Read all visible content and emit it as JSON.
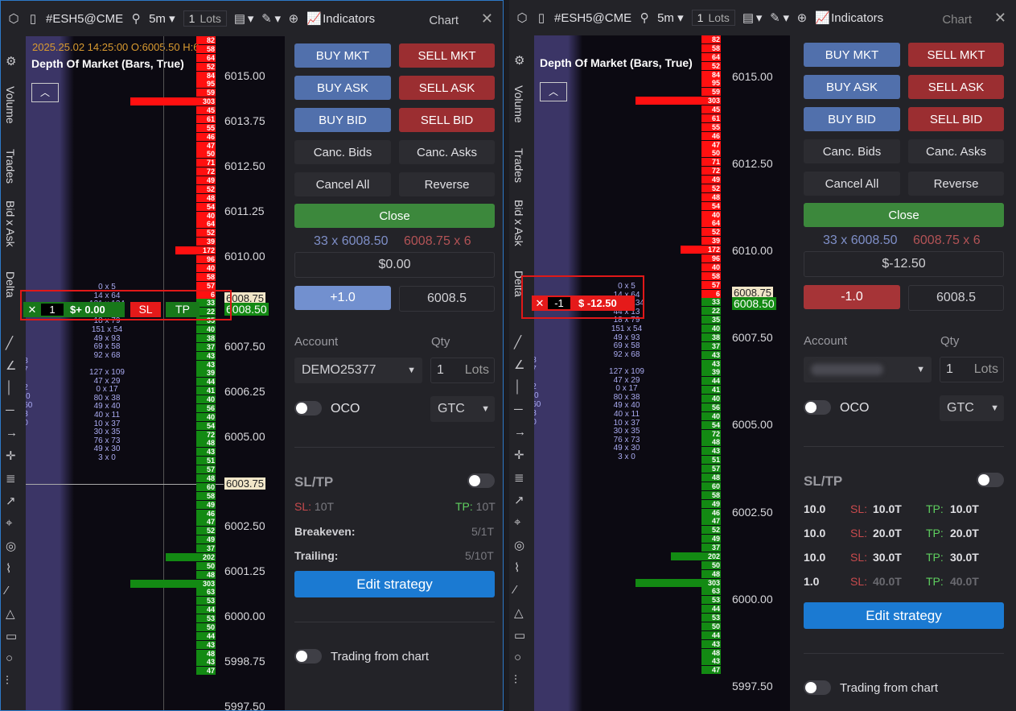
{
  "colors": {
    "buy": "#5170ac",
    "sell": "#9b2e31",
    "close": "#3c883c",
    "strategy": "#1b7ad2",
    "bid_bar": "#138a13",
    "ask_bar": "#ff1010"
  },
  "toolbar": {
    "symbol": "#ESH5@CME",
    "timeframe": "5m",
    "lots_value": "1",
    "lots_unit": "Lots",
    "indicators": "Indicators",
    "chart": "Chart"
  },
  "sidebar_tabs": [
    "Volume",
    "Trades",
    "Bid x Ask",
    "Delta"
  ],
  "left": {
    "info": "2025.25.02 14:25:00 O:6005.50 H:6",
    "study": "Depth Of Market (Bars, True)",
    "prices": [
      "6015.00",
      "6013.75",
      "6012.50",
      "6011.25",
      "6010.00",
      "6008.75",
      "6008.50",
      "6007.50",
      "6006.25",
      "6005.00",
      "6003.75",
      "6002.50",
      "6001.25",
      "6000.00",
      "5998.75",
      "5997.50"
    ],
    "position": {
      "qty": "1",
      "pnl": "$+ 0.00",
      "sl": "SL",
      "tp": "TP"
    },
    "panel": {
      "buy_mkt": "BUY MKT",
      "sell_mkt": "SELL MKT",
      "buy_ask": "BUY ASK",
      "sell_ask": "SELL ASK",
      "buy_bid": "BUY BID",
      "sell_bid": "SELL BID",
      "canc_bids": "Canc. Bids",
      "canc_asks": "Canc. Asks",
      "cancel_all": "Cancel All",
      "reverse": "Reverse",
      "close": "Close",
      "bid": "33 x 6008.50",
      "ask": "6008.75 x 6",
      "pnl": "$0.00",
      "pos": "+1.0",
      "price": "6008.5",
      "account_label": "Account",
      "qty_label": "Qty",
      "account": "DEMO25377",
      "qty": "1",
      "qty_unit": "Lots",
      "oco": "OCO",
      "tif": "GTC",
      "sltp": "SL/TP",
      "sl": "SL:",
      "sl_val": "10T",
      "tp": "TP:",
      "tp_val": "10T",
      "breakeven": "Breakeven:",
      "breakeven_val": "5/1T",
      "trailing": "Trailing:",
      "trailing_val": "5/10T",
      "edit": "Edit strategy",
      "trading": "Trading from chart"
    }
  },
  "right": {
    "study": "Depth Of Market (Bars, True)",
    "prices": [
      "6015.00",
      "6012.50",
      "6010.00",
      "6008.75",
      "6008.50",
      "6007.50",
      "6005.00",
      "6002.50",
      "6000.00",
      "5997.50"
    ],
    "position": {
      "qty": "-1",
      "pnl": "$ -12.50"
    },
    "panel": {
      "bid": "33 x 6008.50",
      "ask": "6008.75 x 6",
      "pnl": "$-12.50",
      "pos": "-1.0",
      "price": "6008.5",
      "account_label": "Account",
      "qty_label": "Qty",
      "qty": "1",
      "qty_unit": "Lots",
      "oco": "OCO",
      "tif": "GTC",
      "sltp": "SL/TP",
      "trading": "Trading from chart",
      "rows": [
        {
          "q": "10.0",
          "sl": "SL:",
          "slv": "10.0T",
          "tp": "TP:",
          "tpv": "10.0T"
        },
        {
          "q": "10.0",
          "sl": "SL:",
          "slv": "20.0T",
          "tp": "TP:",
          "tpv": "20.0T"
        },
        {
          "q": "10.0",
          "sl": "SL:",
          "slv": "30.0T",
          "tp": "TP:",
          "tpv": "30.0T"
        },
        {
          "q": "1.0",
          "sl": "SL:",
          "slv": "40.0T",
          "tp": "TP:",
          "tpv": "40.0T"
        }
      ]
    }
  },
  "asks": [
    "82",
    "58",
    "64",
    "52",
    "84",
    "95",
    "59",
    "303",
    "45",
    "61",
    "55",
    "46",
    "47",
    "50",
    "71",
    "72",
    "49",
    "52",
    "48",
    "54",
    "40",
    "64",
    "52",
    "39",
    "172",
    "96",
    "40",
    "58",
    "57",
    "6"
  ],
  "bids": [
    "33",
    "22",
    "35",
    "40",
    "38",
    "37",
    "43",
    "43",
    "39",
    "44",
    "41",
    "40",
    "56",
    "40",
    "54",
    "72",
    "48",
    "43",
    "51",
    "57",
    "48",
    "60",
    "58",
    "49",
    "46",
    "47",
    "52",
    "49",
    "37",
    "202",
    "50",
    "48",
    "303",
    "63",
    "53",
    "44",
    "53",
    "50",
    "44",
    "43",
    "48",
    "43",
    "47"
  ],
  "footprint": [
    "0 x 5",
    "14 x 64",
    "121 x 134",
    "44 x 13",
    "18 x 79",
    "151 x 54",
    "49 x 93",
    "69 x 58",
    "92 x 68",
    "",
    "127 x 109",
    "47 x 29",
    "0 x 17",
    "80 x 38",
    "49 x 40",
    "40 x 11",
    "10 x 37",
    "30 x 35",
    "76 x 73",
    "49 x 30",
    "3 x 0"
  ],
  "profile_left": [
    "8",
    "7",
    "",
    "2",
    "30",
    "160",
    "3",
    "0"
  ]
}
